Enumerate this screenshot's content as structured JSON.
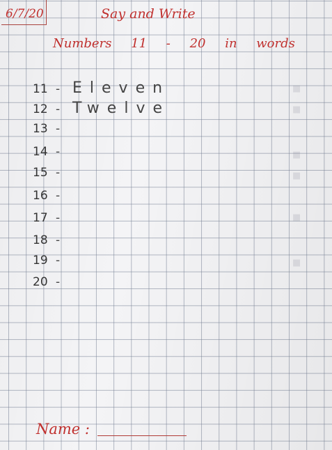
{
  "header": {
    "date": "6/7/20",
    "title": "Say and Write",
    "subtitle": "Numbers 11 - 20 in words"
  },
  "worksheet": {
    "rows": [
      {
        "number": "11",
        "dash": "-",
        "word": "Eleven"
      },
      {
        "number": "12",
        "dash": "-",
        "word": "Twelve"
      },
      {
        "number": "13",
        "dash": "-",
        "word": ""
      },
      {
        "number": "14",
        "dash": "-",
        "word": ""
      },
      {
        "number": "15",
        "dash": "-",
        "word": ""
      },
      {
        "number": "16",
        "dash": "-",
        "word": ""
      },
      {
        "number": "17",
        "dash": "-",
        "word": ""
      },
      {
        "number": "18",
        "dash": "-",
        "word": ""
      },
      {
        "number": "19",
        "dash": "-",
        "word": ""
      },
      {
        "number": "20",
        "dash": "-",
        "word": ""
      }
    ]
  },
  "footer": {
    "name_label": "Name :"
  },
  "colors": {
    "ink_red": "#c0302e",
    "pencil": "#444444",
    "grid": "#7f8aa0"
  }
}
